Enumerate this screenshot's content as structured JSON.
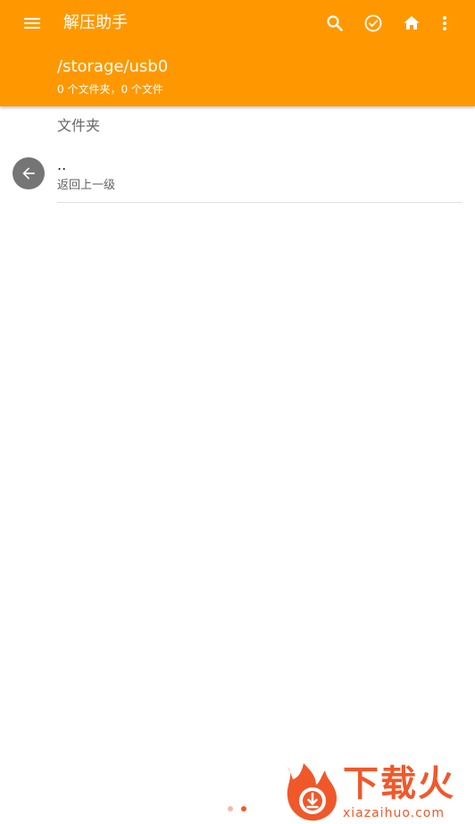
{
  "toolbar": {
    "title": "解压助手",
    "icons": {
      "menu": "menu-icon",
      "search": "search-icon",
      "select": "check-circle-icon",
      "home": "home-icon",
      "more": "more-vert-icon"
    }
  },
  "header": {
    "path": "/storage/usb0",
    "counts": "0 个文件夹，0 个文件"
  },
  "list": {
    "section_title": "文件夹",
    "items": [
      {
        "name": "..",
        "subtitle": "返回上一级",
        "icon": "arrow-back-icon"
      }
    ]
  },
  "watermark": {
    "brand": "下载火",
    "url": "xiazaihuo.com"
  },
  "colors": {
    "primary": "#ff9800",
    "on_primary": "#ffffff",
    "section_text": "#666666",
    "item_icon_bg": "#757575",
    "divider": "#e0e0e0",
    "pager_active": "#f05a28",
    "pager_inactive": "#f6b9a8",
    "watermark": "#f0582a"
  }
}
